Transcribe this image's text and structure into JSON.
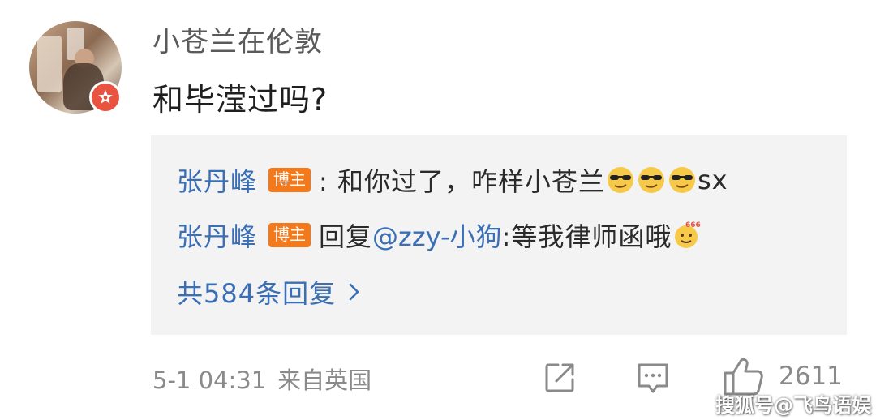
{
  "comment": {
    "username": "小苍兰在伦敦",
    "text": "和毕滢过吗?",
    "avatar_badge_color": "#e8543f"
  },
  "replies": [
    {
      "name": "张丹峰",
      "tag": "博主",
      "text": ": 和你过了，咋样小苍兰",
      "emojis": [
        "cool-sunglasses-emoji",
        "cool-sunglasses-emoji",
        "cool-sunglasses-emoji"
      ],
      "suffix": "sx"
    },
    {
      "name": "张丹峰",
      "tag": "博主",
      "prefix": "回复",
      "mention": "@zzy-小狗",
      "text": ":等我律师函哦",
      "emojis": [
        "666-emoji"
      ]
    }
  ],
  "more_replies": "共584条回复",
  "footer": {
    "time": "5-1 04:31",
    "source": "来自英国",
    "like_count": "2611"
  },
  "watermark": "搜狐号@飞鸟语娱",
  "colors": {
    "link_blue": "#3a6fb5",
    "tag_orange": "#f27a1d",
    "reply_bg": "#f3f3f3"
  }
}
